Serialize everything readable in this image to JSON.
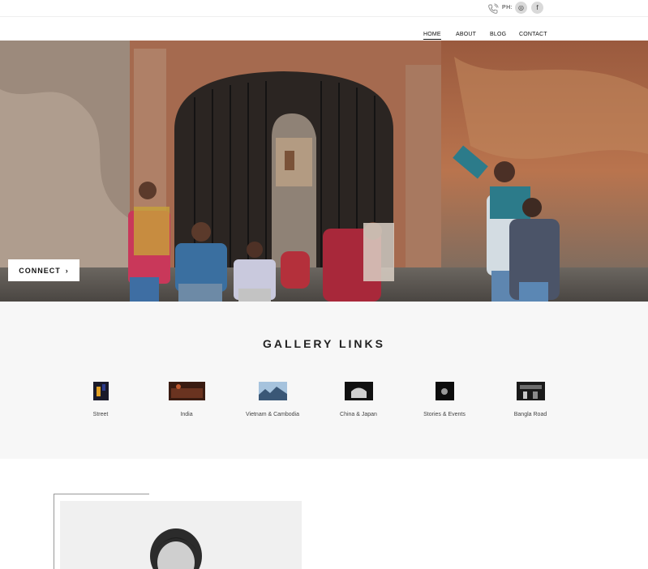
{
  "header": {
    "phone_label": "PH:",
    "social": [
      {
        "icon": "instagram-icon",
        "glyph": "◎"
      },
      {
        "icon": "facebook-icon",
        "glyph": "f"
      }
    ]
  },
  "nav": {
    "items": [
      {
        "label": "HOME",
        "active": true
      },
      {
        "label": "ABOUT",
        "active": false
      },
      {
        "label": "BLOG",
        "active": false
      },
      {
        "label": "CONTACT",
        "active": false
      }
    ]
  },
  "hero": {
    "connect_label": "CONNECT",
    "connect_arrow": "›",
    "slides_total": 8,
    "active_slide": 2
  },
  "gallery": {
    "title": "GALLERY LINKS",
    "items": [
      {
        "label": "Street"
      },
      {
        "label": "India"
      },
      {
        "label": "Vietnam & Cambodia"
      },
      {
        "label": "China & Japan"
      },
      {
        "label": "Stories & Events"
      },
      {
        "label": "Bangla Road"
      }
    ]
  },
  "colors": {
    "accent": "#111111",
    "gallery_bg": "#f7f7f7",
    "social_bg": "#d9d9d9"
  }
}
